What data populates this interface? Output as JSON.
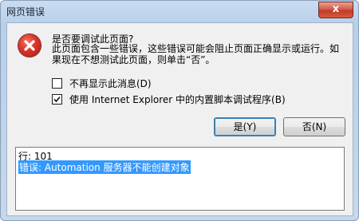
{
  "window": {
    "title": "网页错误",
    "close_label": "x"
  },
  "message": {
    "question": "是否要调试此页面?",
    "detail": "此页面包含一些错误，这些错误可能会阻止页面正确显示或运行。如果现在不想测试此页面，则单击“否”。"
  },
  "options": {
    "dont_show": {
      "label": "不再显示此消息(D)",
      "checked": false
    },
    "use_debugger": {
      "label": "使用 Internet Explorer 中的内置脚本调试程序(B)",
      "checked": true
    }
  },
  "buttons": {
    "yes": "是(Y)",
    "no": "否(N)"
  },
  "details": {
    "line": "行: 101",
    "error": "错误: Automation 服务器不能创建对象"
  },
  "icons": {
    "error": "error-x-icon",
    "check": "check-mark-icon"
  },
  "colors": {
    "error_icon": "#d9342a",
    "selection": "#3399ff",
    "close_button": "#c23a26"
  }
}
